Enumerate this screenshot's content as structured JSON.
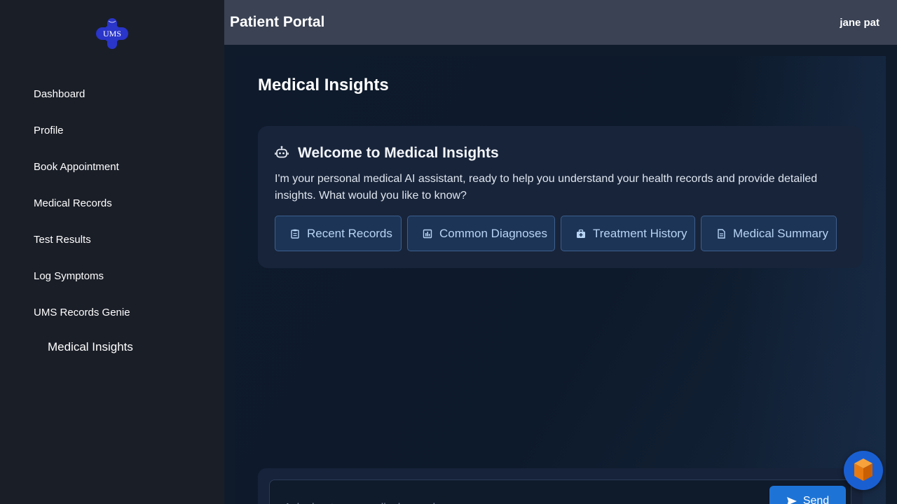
{
  "app": {
    "title": "Patient Portal",
    "user": "jane pat"
  },
  "logo": {
    "text": "UMS",
    "color": "#2a35c9"
  },
  "sidebar": {
    "items": [
      {
        "label": "Dashboard"
      },
      {
        "label": "Profile"
      },
      {
        "label": "Book Appointment"
      },
      {
        "label": "Medical Records"
      },
      {
        "label": "Test Results"
      },
      {
        "label": "Log Symptoms"
      },
      {
        "label": "UMS Records Genie"
      },
      {
        "label": "Medical Insights",
        "active": true
      }
    ]
  },
  "main": {
    "title": "Medical Insights",
    "welcome": {
      "icon": "robot-icon",
      "title": "Welcome to Medical Insights",
      "text": "I'm your personal medical AI assistant, ready to help you understand your health records and provide detailed insights. What would you like to know?"
    },
    "quick_actions": [
      {
        "label": "Recent Records",
        "icon": "clipboard-icon"
      },
      {
        "label": "Common Diagnoses",
        "icon": "bar-chart-icon"
      },
      {
        "label": "Treatment History",
        "icon": "medical-kit-icon"
      },
      {
        "label": "Medical Summary",
        "icon": "document-icon"
      }
    ],
    "chat": {
      "placeholder": "Ask about your medical records...",
      "send_label": "Send",
      "send_icon": "send-icon"
    }
  },
  "colors": {
    "accent": "#1e74d6",
    "chip_bg": "#1c3456",
    "chip_text": "#b7d4f5",
    "fab": "#1a5fd2",
    "fab_cube": "#f08a1c"
  }
}
